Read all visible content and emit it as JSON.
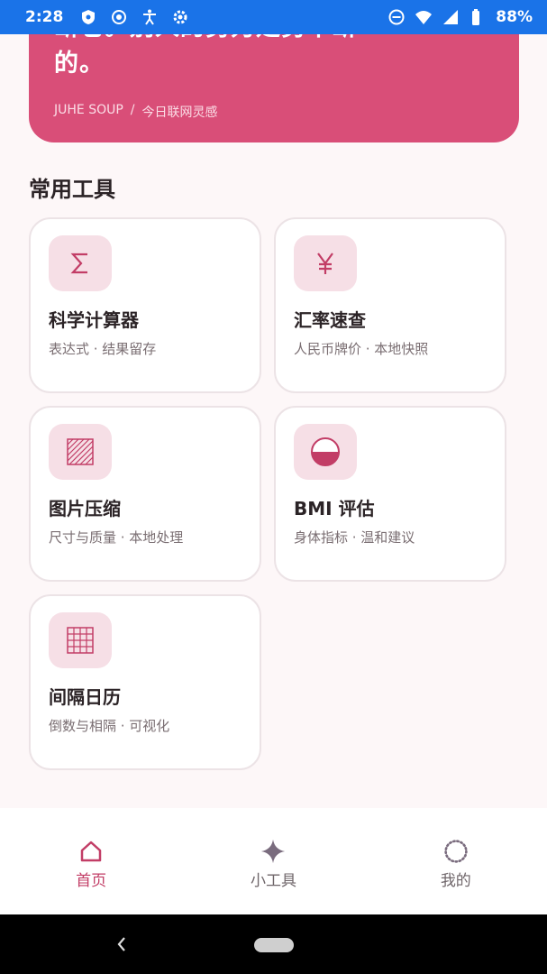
{
  "status_bar": {
    "time": "2:28",
    "battery": "88%",
    "icons": [
      "shield-icon",
      "screen-record-icon",
      "accessibility-icon",
      "settings-gear-icon",
      "do-not-disturb-icon",
      "wifi-icon",
      "cell-signal-icon",
      "battery-icon"
    ]
  },
  "quote": {
    "line1": "断它。别人的努力是努不断",
    "line2": "的。",
    "source_brand": "JUHE SOUP",
    "separator": "/",
    "source_label": "今日联网灵感"
  },
  "tools_section": {
    "title": "常用工具",
    "tools": [
      {
        "name": "科学计算器",
        "desc": "表达式 · 结果留存",
        "icon": "sigma-icon"
      },
      {
        "name": "汇率速查",
        "desc": "人民币牌价 · 本地快照",
        "icon": "yen-icon"
      },
      {
        "name": "图片压缩",
        "desc": "尺寸与质量 · 本地处理",
        "icon": "hatched-square-icon"
      },
      {
        "name": "BMI 评估",
        "desc": "身体指标 · 温和建议",
        "icon": "half-circle-icon"
      },
      {
        "name": "间隔日历",
        "desc": "倒数与相隔 · 可视化",
        "icon": "grid-calendar-icon"
      }
    ]
  },
  "bottom_nav": {
    "items": [
      {
        "label": "首页",
        "icon": "home-icon",
        "active": true
      },
      {
        "label": "小工具",
        "icon": "sparkle-icon",
        "active": false
      },
      {
        "label": "我的",
        "icon": "dotted-circle-icon",
        "active": false
      }
    ]
  },
  "colors": {
    "accent": "#d94e78",
    "icon_color": "#c23d66",
    "status_bar": "#1a73e8"
  }
}
